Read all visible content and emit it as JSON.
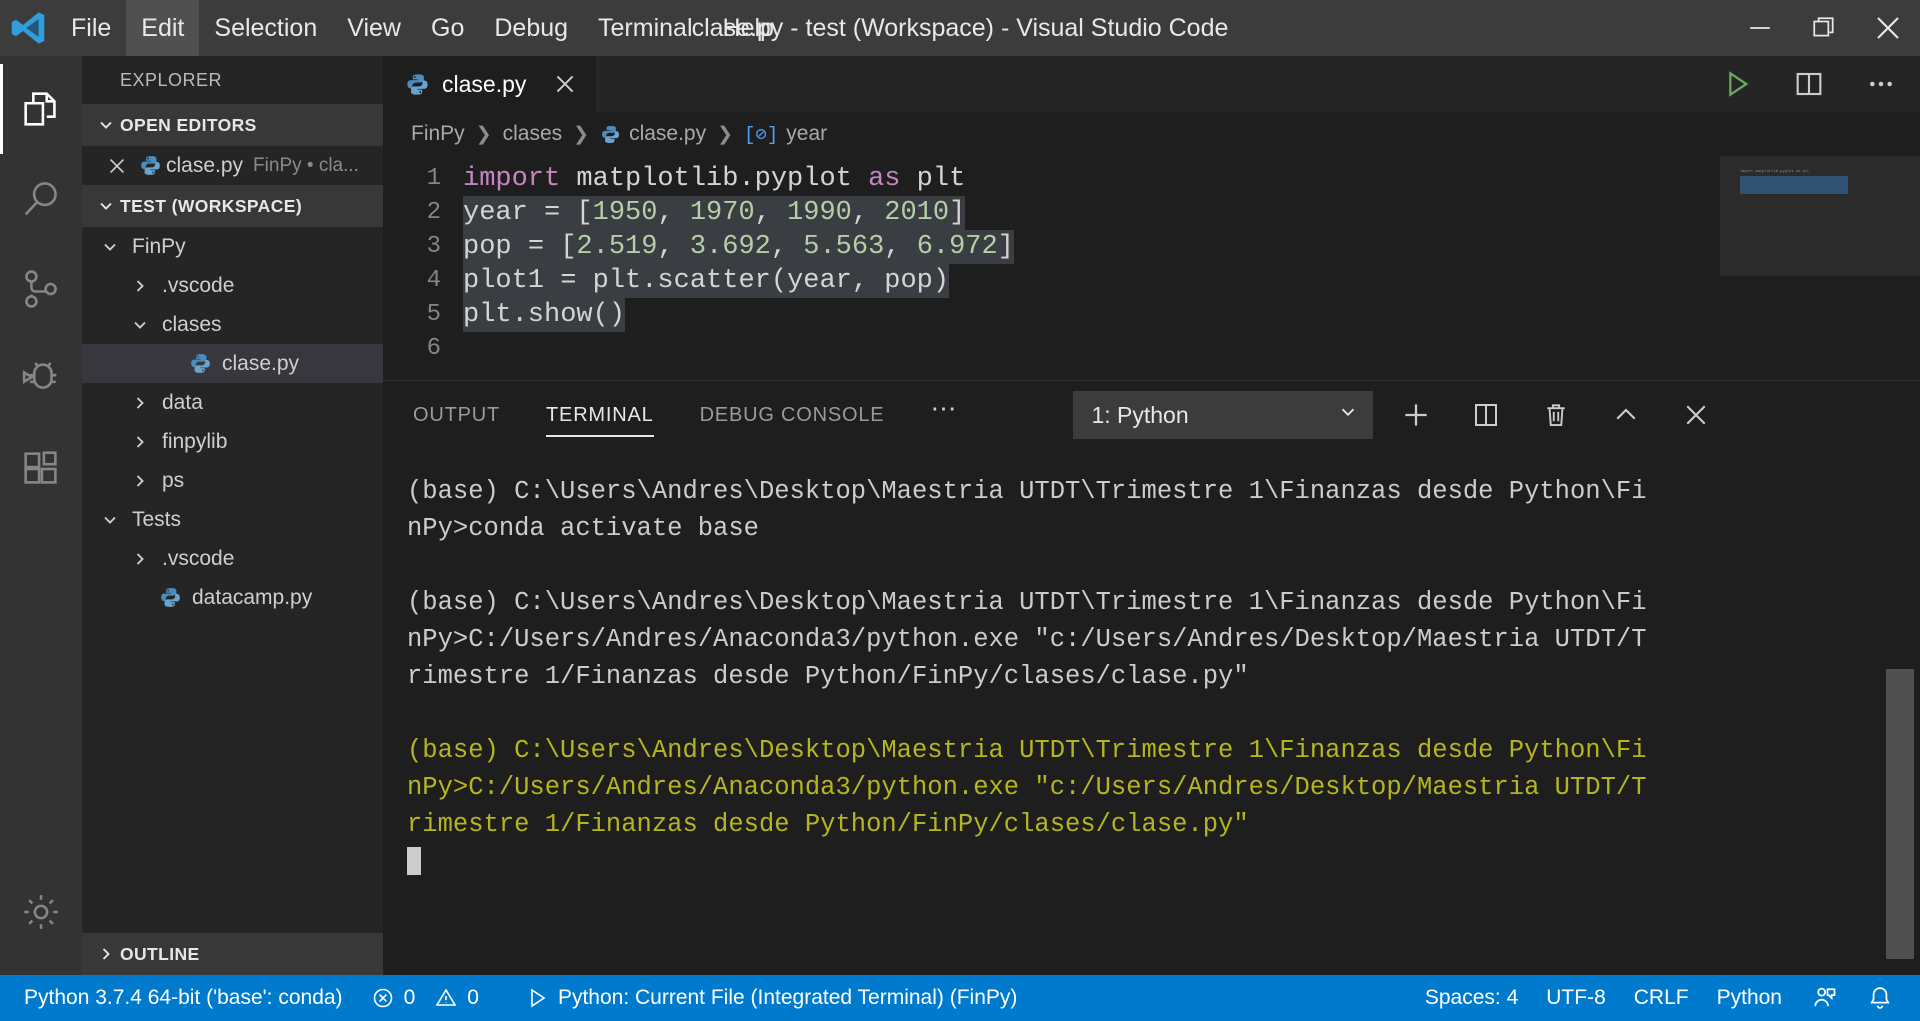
{
  "window": {
    "title": "clase.py - test (Workspace) - Visual Studio Code",
    "minimize_label": "─",
    "restore_label": "❐",
    "close_label": "✕"
  },
  "menu": {
    "items": [
      {
        "label": "File",
        "active": false
      },
      {
        "label": "Edit",
        "active": true
      },
      {
        "label": "Selection",
        "active": false
      },
      {
        "label": "View",
        "active": false
      },
      {
        "label": "Go",
        "active": false
      },
      {
        "label": "Debug",
        "active": false
      },
      {
        "label": "Terminal",
        "active": false
      },
      {
        "label": "Help",
        "active": false
      }
    ]
  },
  "activitybar": {
    "items": [
      {
        "name": "explorer-icon",
        "active": true
      },
      {
        "name": "search-icon",
        "active": false
      },
      {
        "name": "source-control-icon",
        "active": false
      },
      {
        "name": "debug-icon",
        "active": false
      },
      {
        "name": "extensions-icon",
        "active": false
      }
    ],
    "settings": {
      "name": "gear-icon"
    }
  },
  "sidebar": {
    "title": "EXPLORER",
    "sections": [
      {
        "label": "OPEN EDITORS",
        "expanded": true
      },
      {
        "label": "TEST (WORKSPACE)",
        "expanded": true
      },
      {
        "label": "OUTLINE",
        "expanded": false
      }
    ],
    "open_editors": [
      {
        "name": "clase.py",
        "detail": "FinPy • cla...",
        "icon": "python-icon"
      }
    ],
    "tree": [
      {
        "label": "FinPy",
        "indent": 0,
        "kind": "folder",
        "expanded": true,
        "selected": false
      },
      {
        "label": ".vscode",
        "indent": 1,
        "kind": "folder",
        "expanded": false,
        "selected": false
      },
      {
        "label": "clases",
        "indent": 1,
        "kind": "folder",
        "expanded": true,
        "selected": false
      },
      {
        "label": "clase.py",
        "indent": 2,
        "kind": "file",
        "expanded": false,
        "selected": true
      },
      {
        "label": "data",
        "indent": 1,
        "kind": "folder",
        "expanded": false,
        "selected": false
      },
      {
        "label": "finpylib",
        "indent": 1,
        "kind": "folder",
        "expanded": false,
        "selected": false
      },
      {
        "label": "ps",
        "indent": 1,
        "kind": "folder",
        "expanded": false,
        "selected": false
      },
      {
        "label": "Tests",
        "indent": 0,
        "kind": "folder",
        "expanded": true,
        "selected": false
      },
      {
        "label": ".vscode",
        "indent": 1,
        "kind": "folder",
        "expanded": false,
        "selected": false
      },
      {
        "label": "datacamp.py",
        "indent": 1,
        "kind": "file",
        "expanded": false,
        "selected": false
      }
    ]
  },
  "editor": {
    "tabs": [
      {
        "label": "clase.py",
        "icon": "python-icon",
        "active": true,
        "close": "✕"
      }
    ],
    "actions": [
      {
        "name": "run-python-file-icon",
        "label": "Run Python File in Terminal"
      },
      {
        "name": "split-editor-icon",
        "label": "Split Editor"
      },
      {
        "name": "more-actions-icon",
        "label": "More Actions..."
      }
    ],
    "breadcrumb": [
      "FinPy",
      "clases",
      "clase.py",
      "year"
    ],
    "breadcrumb_symbol": "[⊘]",
    "code": {
      "lines": [
        {
          "no": "1",
          "selected": false,
          "tokens": [
            {
              "t": "import",
              "c": "kw"
            },
            {
              "t": " matplotlib.pyplot ",
              "c": "id"
            },
            {
              "t": "as",
              "c": "kw"
            },
            {
              "t": " plt",
              "c": "id"
            }
          ]
        },
        {
          "no": "2",
          "selected": true,
          "tokens": [
            {
              "t": "year ",
              "c": "id"
            },
            {
              "t": "= ",
              "c": "op"
            },
            {
              "t": "[",
              "c": "op"
            },
            {
              "t": "1950",
              "c": "num"
            },
            {
              "t": ", ",
              "c": "op"
            },
            {
              "t": "1970",
              "c": "num"
            },
            {
              "t": ", ",
              "c": "op"
            },
            {
              "t": "1990",
              "c": "num"
            },
            {
              "t": ", ",
              "c": "op"
            },
            {
              "t": "2010",
              "c": "num"
            },
            {
              "t": "]",
              "c": "op"
            }
          ]
        },
        {
          "no": "3",
          "selected": true,
          "tokens": [
            {
              "t": "pop ",
              "c": "id"
            },
            {
              "t": "= ",
              "c": "op"
            },
            {
              "t": "[",
              "c": "op"
            },
            {
              "t": "2.519",
              "c": "num"
            },
            {
              "t": ", ",
              "c": "op"
            },
            {
              "t": "3.692",
              "c": "num"
            },
            {
              "t": ", ",
              "c": "op"
            },
            {
              "t": "5.563",
              "c": "num"
            },
            {
              "t": ", ",
              "c": "op"
            },
            {
              "t": "6.972",
              "c": "num"
            },
            {
              "t": "]",
              "c": "op"
            }
          ]
        },
        {
          "no": "4",
          "selected": true,
          "tokens": [
            {
              "t": "plot1 ",
              "c": "id"
            },
            {
              "t": "= ",
              "c": "op"
            },
            {
              "t": "plt.scatter(",
              "c": "id"
            },
            {
              "t": "year, pop",
              "c": "id"
            },
            {
              "t": ")",
              "c": "id"
            }
          ]
        },
        {
          "no": "5",
          "selected": true,
          "tokens": [
            {
              "t": "plt.show()",
              "c": "id"
            }
          ]
        },
        {
          "no": "6",
          "selected": false,
          "tokens": [
            {
              "t": "",
              "c": "id"
            }
          ]
        }
      ],
      "minimap_text": "import matplotlib.pyplot as plt"
    }
  },
  "panel": {
    "tabs": [
      {
        "label": "OUTPUT",
        "active": false
      },
      {
        "label": "TERMINAL",
        "active": true
      },
      {
        "label": "DEBUG CONSOLE",
        "active": false
      }
    ],
    "more_label": "⋯",
    "terminal_select": {
      "value": "1: Python",
      "chevron": "˅"
    },
    "actions": [
      {
        "name": "new-terminal-icon",
        "label": "New Terminal"
      },
      {
        "name": "split-terminal-icon",
        "label": "Split Terminal"
      },
      {
        "name": "kill-terminal-icon",
        "label": "Kill Terminal"
      },
      {
        "name": "maximize-panel-icon",
        "label": "Maximize Panel Size"
      },
      {
        "name": "close-panel-icon",
        "label": "Close Panel"
      }
    ],
    "terminal_blocks": [
      {
        "highlighted": false,
        "lines": [
          "(base) C:\\Users\\Andres\\Desktop\\Maestria UTDT\\Trimestre 1\\Finanzas desde Python\\Fi",
          "nPy>conda activate base"
        ]
      },
      {
        "highlighted": false,
        "lines": [
          "(base) C:\\Users\\Andres\\Desktop\\Maestria UTDT\\Trimestre 1\\Finanzas desde Python\\Fi",
          "nPy>C:/Users/Andres/Anaconda3/python.exe \"c:/Users/Andres/Desktop/Maestria UTDT/T",
          "rimestre 1/Finanzas desde Python/FinPy/clases/clase.py\""
        ]
      },
      {
        "highlighted": true,
        "lines": [
          "(base) C:\\Users\\Andres\\Desktop\\Maestria UTDT\\Trimestre 1\\Finanzas desde Python\\Fi",
          "nPy>C:/Users/Andres/Anaconda3/python.exe \"c:/Users/Andres/Desktop/Maestria UTDT/T",
          "rimestre 1/Finanzas desde Python/FinPy/clases/clase.py\""
        ]
      }
    ]
  },
  "statusbar": {
    "python_env": "Python 3.7.4 64-bit ('base': conda)",
    "errors": "0",
    "warnings": "0",
    "run_config": "Python: Current File (Integrated Terminal) (FinPy)",
    "spaces": "Spaces: 4",
    "encoding": "UTF-8",
    "eol": "CRLF",
    "language": "Python",
    "feedback_icon": "smiley-feedback-icon",
    "bell_icon": "bell-icon"
  },
  "colors": {
    "accent": "#007acc",
    "titlebar_bg": "#3c3c3c",
    "sidebar_bg": "#252526",
    "editor_bg": "#1e1e1e",
    "activitybar_bg": "#333333",
    "selection": "#3a3d41",
    "terminal_highlight": "#b5b51f",
    "run_green": "#6aab5a"
  }
}
